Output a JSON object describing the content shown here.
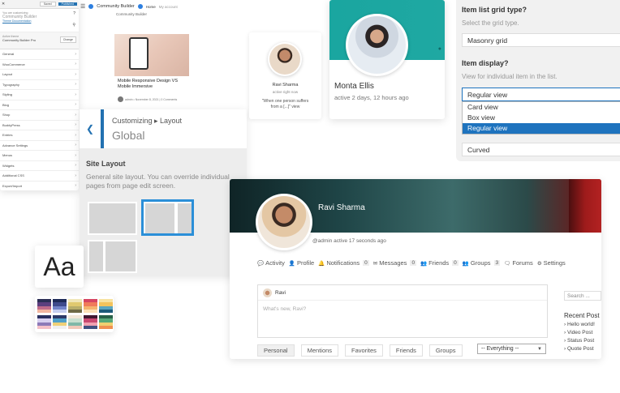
{
  "customizer": {
    "close": "✕",
    "save_label": "Saved",
    "publish_label": "Published",
    "you_are_customizing": "You are customizing",
    "site_title": "Community Builder",
    "theme_docs": "Theme Documentation",
    "active_theme_label": "Active theme",
    "active_theme": "Community Builder Pro",
    "change_label": "Change",
    "menu": [
      "General",
      "WooCommerce",
      "Layout",
      "Typography",
      "Styling",
      "Blog",
      "Shop",
      "BuddyPress",
      "Entries",
      "Advance Settings",
      "Menus",
      "Widgets",
      "Additional CSS",
      "Export/Import"
    ]
  },
  "blog_preview": {
    "brand": "Community Builder",
    "nav": [
      "Home",
      "My account"
    ],
    "site_name": "Community Builder",
    "post_title": "Mobile Responsive Design VS Mobile Immersive",
    "meta": "admin  •  November 8, 2021  |  0 Comments"
  },
  "customize_panel": {
    "breadcrumb": "Customizing ▸ Layout",
    "title": "Global",
    "section_title": "Site Layout",
    "description": "General site layout. You can override individual pages from page edit screen."
  },
  "typography_tile": {
    "sample": "Aa"
  },
  "palettes": [
    [
      "#2b2f55",
      "#5c3f7e",
      "#c06b8a",
      "#f2b6a0"
    ],
    [
      "#1e2a58",
      "#3e4a8c",
      "#7283c9",
      "#c5cef0"
    ],
    [
      "#f0e6b8",
      "#e0c96f",
      "#b8ad6a",
      "#6e6a45"
    ],
    [
      "#d64562",
      "#f07b5a",
      "#f5b46e",
      "#fce1b6"
    ],
    [
      "#f7e2a0",
      "#f3c35c",
      "#5aa5c0",
      "#1c5a7a"
    ],
    [
      "#2a3060",
      "#d8d0f0",
      "#8c7ab8",
      "#f4c0c8"
    ],
    [
      "#2c3968",
      "#50a0c8",
      "#f0d078",
      "#f0f0f0"
    ],
    [
      "#f2e8d8",
      "#c8e0d0",
      "#80b8a8",
      "#f0c8b8"
    ],
    [
      "#401830",
      "#c84870",
      "#f0a0b0",
      "#405080"
    ],
    [
      "#286048",
      "#58a878",
      "#f0d070",
      "#f09050"
    ]
  ],
  "member_small": {
    "name": "Ravi Sharma",
    "status": "active right now",
    "quote": "\"When one person suffers from a [...]\" view"
  },
  "member_big": {
    "name": "Monta Ellis",
    "status": "active 2 days, 12 hours ago"
  },
  "settings": {
    "grid_type_label": "Item list grid type?",
    "grid_type_help": "Select the grid type.",
    "grid_type_value": "Masonry grid",
    "display_label": "Item display?",
    "display_help": "View for individual item in the list.",
    "display_value": "Regular view",
    "display_options": [
      "Card view",
      "Box view",
      "Regular view"
    ],
    "display_selected_index": 2,
    "shape_value": "Curved"
  },
  "profile": {
    "name": "Ravi Sharma",
    "handle": "@admin",
    "activity": "active 17 seconds ago",
    "tabs": [
      {
        "icon": "activity-icon",
        "label": "Activity",
        "glyph": "💬",
        "count": ""
      },
      {
        "icon": "profile-icon",
        "label": "Profile",
        "glyph": "👤",
        "count": ""
      },
      {
        "icon": "bell-icon",
        "label": "Notifications",
        "glyph": "🔔",
        "count": "0"
      },
      {
        "icon": "envelope-icon",
        "label": "Messages",
        "glyph": "✉",
        "count": "0"
      },
      {
        "icon": "friends-icon",
        "label": "Friends",
        "glyph": "👥",
        "count": "0"
      },
      {
        "icon": "groups-icon",
        "label": "Groups",
        "glyph": "👥",
        "count": "3"
      },
      {
        "icon": "forums-icon",
        "label": "Forums",
        "glyph": "🗨",
        "count": ""
      },
      {
        "icon": "gear-icon",
        "label": "Settings",
        "glyph": "⚙",
        "count": ""
      }
    ],
    "composer_user": "Ravi",
    "composer_placeholder": "What's new, Ravi?",
    "filters": [
      "Personal",
      "Mentions",
      "Favorites",
      "Friends",
      "Groups"
    ],
    "scope": "-- Everything --",
    "search_placeholder": "Search ...",
    "recent_posts_title": "Recent Post",
    "recent_posts": [
      "Hello world!",
      "Video Post",
      "Status Post",
      "Quote Post"
    ]
  }
}
